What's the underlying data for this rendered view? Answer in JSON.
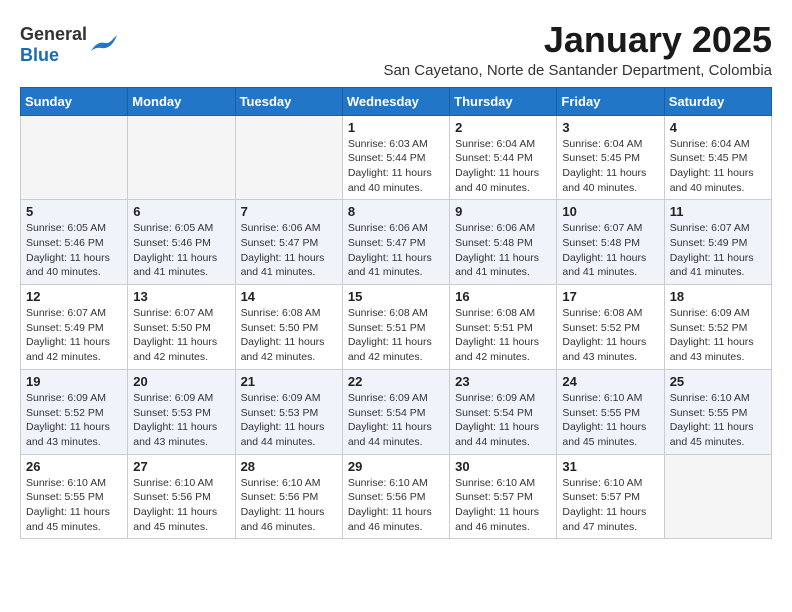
{
  "logo": {
    "general": "General",
    "blue": "Blue"
  },
  "title": "January 2025",
  "subtitle": "San Cayetano, Norte de Santander Department, Colombia",
  "weekdays": [
    "Sunday",
    "Monday",
    "Tuesday",
    "Wednesday",
    "Thursday",
    "Friday",
    "Saturday"
  ],
  "weeks": [
    [
      {
        "day": "",
        "info": ""
      },
      {
        "day": "",
        "info": ""
      },
      {
        "day": "",
        "info": ""
      },
      {
        "day": "1",
        "info": "Sunrise: 6:03 AM\nSunset: 5:44 PM\nDaylight: 11 hours\nand 40 minutes."
      },
      {
        "day": "2",
        "info": "Sunrise: 6:04 AM\nSunset: 5:44 PM\nDaylight: 11 hours\nand 40 minutes."
      },
      {
        "day": "3",
        "info": "Sunrise: 6:04 AM\nSunset: 5:45 PM\nDaylight: 11 hours\nand 40 minutes."
      },
      {
        "day": "4",
        "info": "Sunrise: 6:04 AM\nSunset: 5:45 PM\nDaylight: 11 hours\nand 40 minutes."
      }
    ],
    [
      {
        "day": "5",
        "info": "Sunrise: 6:05 AM\nSunset: 5:46 PM\nDaylight: 11 hours\nand 40 minutes."
      },
      {
        "day": "6",
        "info": "Sunrise: 6:05 AM\nSunset: 5:46 PM\nDaylight: 11 hours\nand 41 minutes."
      },
      {
        "day": "7",
        "info": "Sunrise: 6:06 AM\nSunset: 5:47 PM\nDaylight: 11 hours\nand 41 minutes."
      },
      {
        "day": "8",
        "info": "Sunrise: 6:06 AM\nSunset: 5:47 PM\nDaylight: 11 hours\nand 41 minutes."
      },
      {
        "day": "9",
        "info": "Sunrise: 6:06 AM\nSunset: 5:48 PM\nDaylight: 11 hours\nand 41 minutes."
      },
      {
        "day": "10",
        "info": "Sunrise: 6:07 AM\nSunset: 5:48 PM\nDaylight: 11 hours\nand 41 minutes."
      },
      {
        "day": "11",
        "info": "Sunrise: 6:07 AM\nSunset: 5:49 PM\nDaylight: 11 hours\nand 41 minutes."
      }
    ],
    [
      {
        "day": "12",
        "info": "Sunrise: 6:07 AM\nSunset: 5:49 PM\nDaylight: 11 hours\nand 42 minutes."
      },
      {
        "day": "13",
        "info": "Sunrise: 6:07 AM\nSunset: 5:50 PM\nDaylight: 11 hours\nand 42 minutes."
      },
      {
        "day": "14",
        "info": "Sunrise: 6:08 AM\nSunset: 5:50 PM\nDaylight: 11 hours\nand 42 minutes."
      },
      {
        "day": "15",
        "info": "Sunrise: 6:08 AM\nSunset: 5:51 PM\nDaylight: 11 hours\nand 42 minutes."
      },
      {
        "day": "16",
        "info": "Sunrise: 6:08 AM\nSunset: 5:51 PM\nDaylight: 11 hours\nand 42 minutes."
      },
      {
        "day": "17",
        "info": "Sunrise: 6:08 AM\nSunset: 5:52 PM\nDaylight: 11 hours\nand 43 minutes."
      },
      {
        "day": "18",
        "info": "Sunrise: 6:09 AM\nSunset: 5:52 PM\nDaylight: 11 hours\nand 43 minutes."
      }
    ],
    [
      {
        "day": "19",
        "info": "Sunrise: 6:09 AM\nSunset: 5:52 PM\nDaylight: 11 hours\nand 43 minutes."
      },
      {
        "day": "20",
        "info": "Sunrise: 6:09 AM\nSunset: 5:53 PM\nDaylight: 11 hours\nand 43 minutes."
      },
      {
        "day": "21",
        "info": "Sunrise: 6:09 AM\nSunset: 5:53 PM\nDaylight: 11 hours\nand 44 minutes."
      },
      {
        "day": "22",
        "info": "Sunrise: 6:09 AM\nSunset: 5:54 PM\nDaylight: 11 hours\nand 44 minutes."
      },
      {
        "day": "23",
        "info": "Sunrise: 6:09 AM\nSunset: 5:54 PM\nDaylight: 11 hours\nand 44 minutes."
      },
      {
        "day": "24",
        "info": "Sunrise: 6:10 AM\nSunset: 5:55 PM\nDaylight: 11 hours\nand 45 minutes."
      },
      {
        "day": "25",
        "info": "Sunrise: 6:10 AM\nSunset: 5:55 PM\nDaylight: 11 hours\nand 45 minutes."
      }
    ],
    [
      {
        "day": "26",
        "info": "Sunrise: 6:10 AM\nSunset: 5:55 PM\nDaylight: 11 hours\nand 45 minutes."
      },
      {
        "day": "27",
        "info": "Sunrise: 6:10 AM\nSunset: 5:56 PM\nDaylight: 11 hours\nand 45 minutes."
      },
      {
        "day": "28",
        "info": "Sunrise: 6:10 AM\nSunset: 5:56 PM\nDaylight: 11 hours\nand 46 minutes."
      },
      {
        "day": "29",
        "info": "Sunrise: 6:10 AM\nSunset: 5:56 PM\nDaylight: 11 hours\nand 46 minutes."
      },
      {
        "day": "30",
        "info": "Sunrise: 6:10 AM\nSunset: 5:57 PM\nDaylight: 11 hours\nand 46 minutes."
      },
      {
        "day": "31",
        "info": "Sunrise: 6:10 AM\nSunset: 5:57 PM\nDaylight: 11 hours\nand 47 minutes."
      },
      {
        "day": "",
        "info": ""
      }
    ]
  ]
}
